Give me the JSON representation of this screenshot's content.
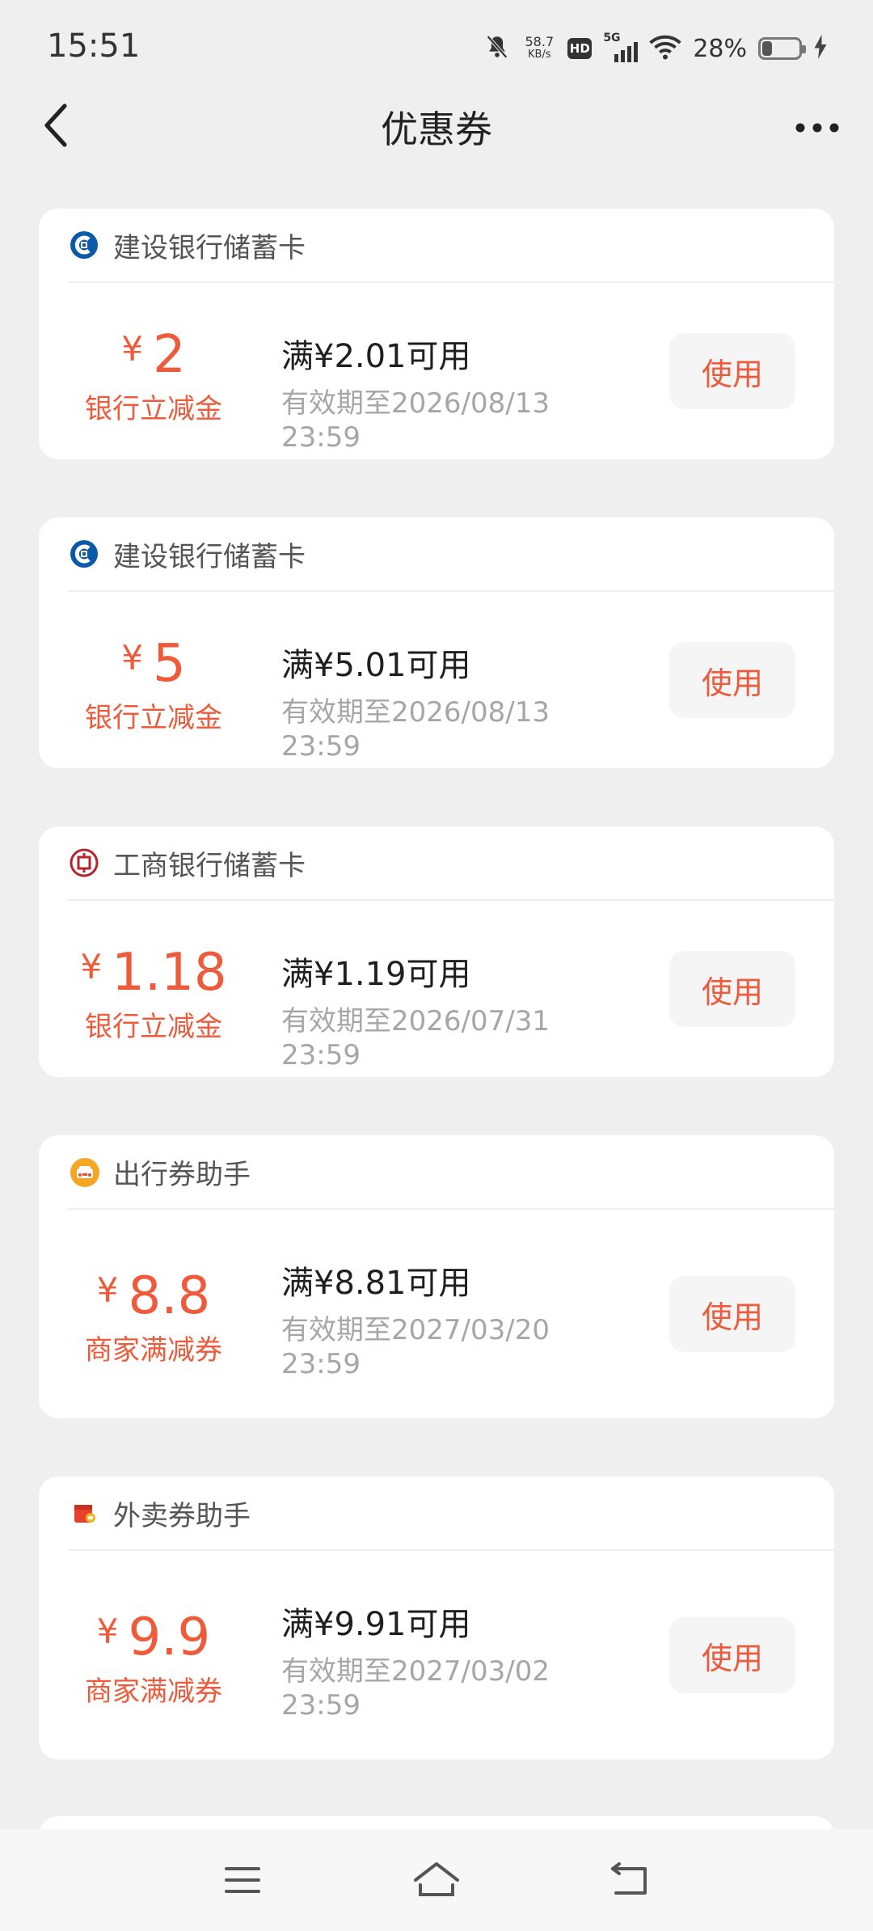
{
  "status_bar": {
    "time": "15:51",
    "net_speed_value": "58.7",
    "net_speed_unit": "KB/s",
    "hd_label": "HD",
    "network_label": "5G",
    "battery_text": "28%",
    "battery_level": 0.28
  },
  "header": {
    "title": "优惠券"
  },
  "coupons": [
    {
      "bank_name": "建设银行储蓄卡",
      "icon": "ccb-logo-icon",
      "currency": "¥",
      "amount": "2",
      "type": "银行立减金",
      "condition": "满¥2.01可用",
      "validity": "有效期至2026/08/13 23:59",
      "button": "使用"
    },
    {
      "bank_name": "建设银行储蓄卡",
      "icon": "ccb-logo-icon",
      "currency": "¥",
      "amount": "5",
      "type": "银行立减金",
      "condition": "满¥5.01可用",
      "validity": "有效期至2026/08/13 23:59",
      "button": "使用"
    },
    {
      "bank_name": "工商银行储蓄卡",
      "icon": "icbc-logo-icon",
      "currency": "¥",
      "amount": "1.18",
      "type": "银行立减金",
      "condition": "满¥1.19可用",
      "validity": "有效期至2026/07/31 23:59",
      "button": "使用"
    },
    {
      "bank_name": "出行券助手",
      "icon": "travel-car-icon",
      "currency": "¥",
      "amount": "8.8",
      "type": "商家满减券",
      "condition": "满¥8.81可用",
      "validity": "有效期至2027/03/20 23:59",
      "button": "使用"
    },
    {
      "bank_name": "外卖券助手",
      "icon": "takeout-bag-icon",
      "currency": "¥",
      "amount": "9.9",
      "type": "商家满减券",
      "condition": "满¥9.91可用",
      "validity": "有效期至2027/03/02 23:59",
      "button": "使用"
    }
  ],
  "colors": {
    "accent": "#ef5a3a",
    "background": "#efefef",
    "card": "#ffffff"
  }
}
